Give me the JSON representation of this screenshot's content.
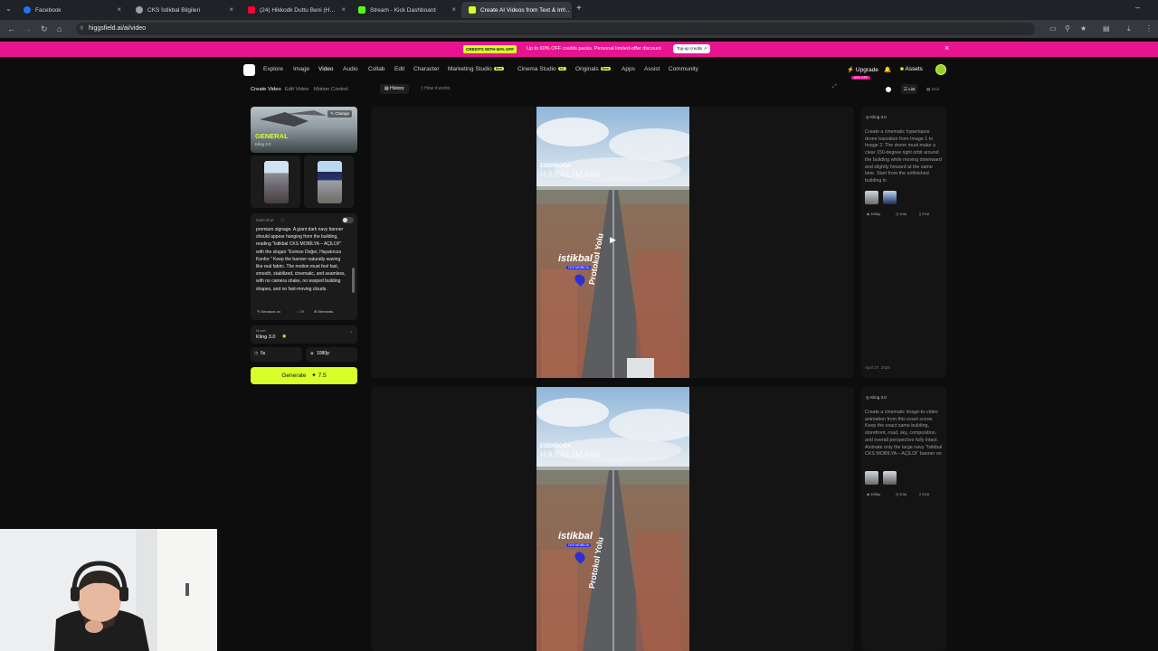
{
  "browser": {
    "tabs": [
      {
        "label": "Facebook",
        "color": "#1877f2"
      },
      {
        "label": "CKS İstikbal Bilgileri",
        "color": "#9aa0a6"
      },
      {
        "label": "(24) Hikkodk Duttu Beni (H…",
        "color": "#ff0033"
      },
      {
        "label": "Stream - Kick Dashboard",
        "color": "#53fc18"
      },
      {
        "label": "Create AI Videos from Text & Im…",
        "color": "#d9ff2a"
      }
    ],
    "url": "higgsfield.ai/ai/video"
  },
  "promo": {
    "badge": "CREDITS WITH 60% OFF",
    "text": "Up to 60% OFF credits packs. Personal limited-offer discount",
    "button": "Top-up credits ↗"
  },
  "nav": {
    "items": [
      "Explore",
      "Image",
      "Video",
      "Audio",
      "Collab",
      "Edit",
      "Character",
      "Marketing Studio",
      "Cinema Studio",
      "Originals",
      "Apps",
      "Assist",
      "Community"
    ],
    "new_tag": "New",
    "cinema_tag": "3.0",
    "upgrade": "Upgrade",
    "upgrade_badge": "60% OFF",
    "assets": "Assets"
  },
  "left": {
    "tabs": [
      "Create Video",
      "Edit Video",
      "Motion Control"
    ],
    "preset_title": "GENERAL",
    "preset_sub": "Kling 3.0",
    "change_label": "Change",
    "multishot_label": "Multi-shot",
    "prompt": "premium signage. A giant dark navy banner should appear hanging from the building, reading \"Istikbal CKS MOBİLYA – AÇILDI!\" with the slogan \"Evinize Değer, Hayatınıza Konfor.\" Keep the banner naturally waving like real fabric. The motion must feel fast, smooth, stabilized, cinematic, and seamless, with no camera shake, no warped building shapes, and no fast-moving clouds.",
    "enhance_label": "Enhance on",
    "off_label": "Off",
    "elements_label": "Elements",
    "model_label": "Model",
    "model_value": "Kling 3.0",
    "duration": "5s",
    "resolution": "1080p",
    "generate_label": "Generate",
    "generate_cost": "7.5"
  },
  "toolbar": {
    "history": "History",
    "how_it_works": "How it works",
    "list": "List",
    "grid": "Grid"
  },
  "results": [
    {
      "overlay_top": "ESENBOĞA",
      "overlay_big": "HAVALİMANI",
      "brand": "istikbal",
      "brand_sub": "CKS MOBİLYA",
      "road_text": "Protokol Yolu",
      "model": "Kling 3.0",
      "prompt": "Create a cinematic hyperlapse drone transition from Image 1 to Image 2. The drone must make a clear 150-degree right orbit around the building while moving downward and slightly forward at the same time. Start from the unfinished building in",
      "res": "1080p",
      "dur": "5.0s",
      "ratio": "9:16",
      "date": "April 27, 2026"
    },
    {
      "overlay_top": "ESENBOĞA",
      "overlay_big": "HAVALİMANI",
      "brand": "istikbal",
      "brand_sub": "CKS MOBİLYA",
      "road_text": "Protokol Yolu",
      "model": "Kling 3.0",
      "prompt": "Create a cinematic image-to-video animation from this exact scene. Keep the exact same building, storefront, road, sky, composition, and overall perspective fully intact. Animate only the large navy \"Istikbal CKS MOBİLYA – AÇILDI\" banner on",
      "res": "1080p",
      "dur": "5.0s",
      "ratio": "9:16"
    }
  ],
  "colors": {
    "accent": "#d9ff2a",
    "promo": "#e7138f",
    "brand_blue": "#2a2fd6"
  }
}
